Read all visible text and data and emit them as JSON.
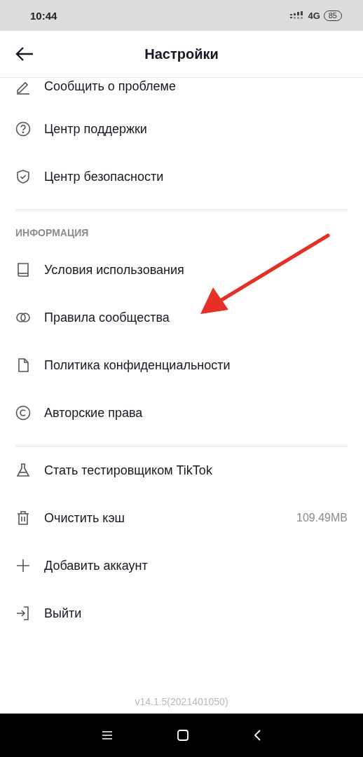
{
  "status_bar": {
    "time": "10:44",
    "network": "4G",
    "battery": "85"
  },
  "header": {
    "title": "Настройки"
  },
  "groups": [
    {
      "items": [
        {
          "label": "Сообщить о проблеме"
        },
        {
          "label": "Центр поддержки"
        },
        {
          "label": "Центр безопасности"
        }
      ]
    },
    {
      "title": "ИНФОРМАЦИЯ",
      "items": [
        {
          "label": "Условия использования"
        },
        {
          "label": "Правила сообщества"
        },
        {
          "label": "Политика конфиденциальности"
        },
        {
          "label": "Авторские права"
        }
      ]
    },
    {
      "items": [
        {
          "label": "Стать тестировщиком TikTok"
        },
        {
          "label": "Очистить кэш",
          "value": "109.49MB"
        },
        {
          "label": "Добавить аккаунт"
        },
        {
          "label": "Выйти"
        }
      ]
    }
  ],
  "version": "v14.1.5(2021401050)"
}
